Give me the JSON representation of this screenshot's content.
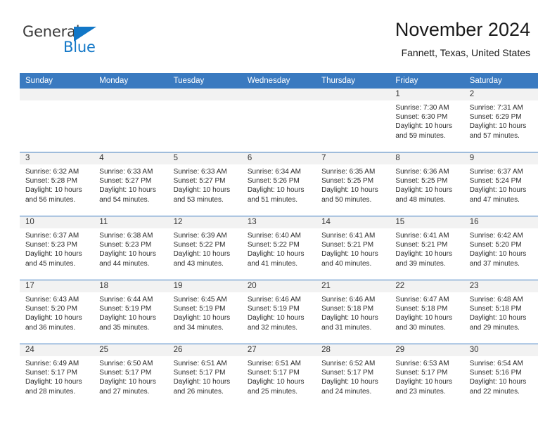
{
  "brand": {
    "name_part1": "General",
    "name_part2": "Blue",
    "accent_color": "#1277c7"
  },
  "header": {
    "title": "November 2024",
    "subtitle": "Fannett, Texas, United States"
  },
  "calendar": {
    "header_color": "#3a7ac0",
    "weekday_headers": [
      "Sunday",
      "Monday",
      "Tuesday",
      "Wednesday",
      "Thursday",
      "Friday",
      "Saturday"
    ],
    "weeks": [
      [
        {
          "day": "",
          "empty": true
        },
        {
          "day": "",
          "empty": true
        },
        {
          "day": "",
          "empty": true
        },
        {
          "day": "",
          "empty": true
        },
        {
          "day": "",
          "empty": true
        },
        {
          "day": "1",
          "sunrise": "Sunrise: 7:30 AM",
          "sunset": "Sunset: 6:30 PM",
          "daylight1": "Daylight: 10 hours",
          "daylight2": "and 59 minutes."
        },
        {
          "day": "2",
          "sunrise": "Sunrise: 7:31 AM",
          "sunset": "Sunset: 6:29 PM",
          "daylight1": "Daylight: 10 hours",
          "daylight2": "and 57 minutes."
        }
      ],
      [
        {
          "day": "3",
          "sunrise": "Sunrise: 6:32 AM",
          "sunset": "Sunset: 5:28 PM",
          "daylight1": "Daylight: 10 hours",
          "daylight2": "and 56 minutes."
        },
        {
          "day": "4",
          "sunrise": "Sunrise: 6:33 AM",
          "sunset": "Sunset: 5:27 PM",
          "daylight1": "Daylight: 10 hours",
          "daylight2": "and 54 minutes."
        },
        {
          "day": "5",
          "sunrise": "Sunrise: 6:33 AM",
          "sunset": "Sunset: 5:27 PM",
          "daylight1": "Daylight: 10 hours",
          "daylight2": "and 53 minutes."
        },
        {
          "day": "6",
          "sunrise": "Sunrise: 6:34 AM",
          "sunset": "Sunset: 5:26 PM",
          "daylight1": "Daylight: 10 hours",
          "daylight2": "and 51 minutes."
        },
        {
          "day": "7",
          "sunrise": "Sunrise: 6:35 AM",
          "sunset": "Sunset: 5:25 PM",
          "daylight1": "Daylight: 10 hours",
          "daylight2": "and 50 minutes."
        },
        {
          "day": "8",
          "sunrise": "Sunrise: 6:36 AM",
          "sunset": "Sunset: 5:25 PM",
          "daylight1": "Daylight: 10 hours",
          "daylight2": "and 48 minutes."
        },
        {
          "day": "9",
          "sunrise": "Sunrise: 6:37 AM",
          "sunset": "Sunset: 5:24 PM",
          "daylight1": "Daylight: 10 hours",
          "daylight2": "and 47 minutes."
        }
      ],
      [
        {
          "day": "10",
          "sunrise": "Sunrise: 6:37 AM",
          "sunset": "Sunset: 5:23 PM",
          "daylight1": "Daylight: 10 hours",
          "daylight2": "and 45 minutes."
        },
        {
          "day": "11",
          "sunrise": "Sunrise: 6:38 AM",
          "sunset": "Sunset: 5:23 PM",
          "daylight1": "Daylight: 10 hours",
          "daylight2": "and 44 minutes."
        },
        {
          "day": "12",
          "sunrise": "Sunrise: 6:39 AM",
          "sunset": "Sunset: 5:22 PM",
          "daylight1": "Daylight: 10 hours",
          "daylight2": "and 43 minutes."
        },
        {
          "day": "13",
          "sunrise": "Sunrise: 6:40 AM",
          "sunset": "Sunset: 5:22 PM",
          "daylight1": "Daylight: 10 hours",
          "daylight2": "and 41 minutes."
        },
        {
          "day": "14",
          "sunrise": "Sunrise: 6:41 AM",
          "sunset": "Sunset: 5:21 PM",
          "daylight1": "Daylight: 10 hours",
          "daylight2": "and 40 minutes."
        },
        {
          "day": "15",
          "sunrise": "Sunrise: 6:41 AM",
          "sunset": "Sunset: 5:21 PM",
          "daylight1": "Daylight: 10 hours",
          "daylight2": "and 39 minutes."
        },
        {
          "day": "16",
          "sunrise": "Sunrise: 6:42 AM",
          "sunset": "Sunset: 5:20 PM",
          "daylight1": "Daylight: 10 hours",
          "daylight2": "and 37 minutes."
        }
      ],
      [
        {
          "day": "17",
          "sunrise": "Sunrise: 6:43 AM",
          "sunset": "Sunset: 5:20 PM",
          "daylight1": "Daylight: 10 hours",
          "daylight2": "and 36 minutes."
        },
        {
          "day": "18",
          "sunrise": "Sunrise: 6:44 AM",
          "sunset": "Sunset: 5:19 PM",
          "daylight1": "Daylight: 10 hours",
          "daylight2": "and 35 minutes."
        },
        {
          "day": "19",
          "sunrise": "Sunrise: 6:45 AM",
          "sunset": "Sunset: 5:19 PM",
          "daylight1": "Daylight: 10 hours",
          "daylight2": "and 34 minutes."
        },
        {
          "day": "20",
          "sunrise": "Sunrise: 6:46 AM",
          "sunset": "Sunset: 5:19 PM",
          "daylight1": "Daylight: 10 hours",
          "daylight2": "and 32 minutes."
        },
        {
          "day": "21",
          "sunrise": "Sunrise: 6:46 AM",
          "sunset": "Sunset: 5:18 PM",
          "daylight1": "Daylight: 10 hours",
          "daylight2": "and 31 minutes."
        },
        {
          "day": "22",
          "sunrise": "Sunrise: 6:47 AM",
          "sunset": "Sunset: 5:18 PM",
          "daylight1": "Daylight: 10 hours",
          "daylight2": "and 30 minutes."
        },
        {
          "day": "23",
          "sunrise": "Sunrise: 6:48 AM",
          "sunset": "Sunset: 5:18 PM",
          "daylight1": "Daylight: 10 hours",
          "daylight2": "and 29 minutes."
        }
      ],
      [
        {
          "day": "24",
          "sunrise": "Sunrise: 6:49 AM",
          "sunset": "Sunset: 5:17 PM",
          "daylight1": "Daylight: 10 hours",
          "daylight2": "and 28 minutes."
        },
        {
          "day": "25",
          "sunrise": "Sunrise: 6:50 AM",
          "sunset": "Sunset: 5:17 PM",
          "daylight1": "Daylight: 10 hours",
          "daylight2": "and 27 minutes."
        },
        {
          "day": "26",
          "sunrise": "Sunrise: 6:51 AM",
          "sunset": "Sunset: 5:17 PM",
          "daylight1": "Daylight: 10 hours",
          "daylight2": "and 26 minutes."
        },
        {
          "day": "27",
          "sunrise": "Sunrise: 6:51 AM",
          "sunset": "Sunset: 5:17 PM",
          "daylight1": "Daylight: 10 hours",
          "daylight2": "and 25 minutes."
        },
        {
          "day": "28",
          "sunrise": "Sunrise: 6:52 AM",
          "sunset": "Sunset: 5:17 PM",
          "daylight1": "Daylight: 10 hours",
          "daylight2": "and 24 minutes."
        },
        {
          "day": "29",
          "sunrise": "Sunrise: 6:53 AM",
          "sunset": "Sunset: 5:17 PM",
          "daylight1": "Daylight: 10 hours",
          "daylight2": "and 23 minutes."
        },
        {
          "day": "30",
          "sunrise": "Sunrise: 6:54 AM",
          "sunset": "Sunset: 5:16 PM",
          "daylight1": "Daylight: 10 hours",
          "daylight2": "and 22 minutes."
        }
      ]
    ]
  }
}
